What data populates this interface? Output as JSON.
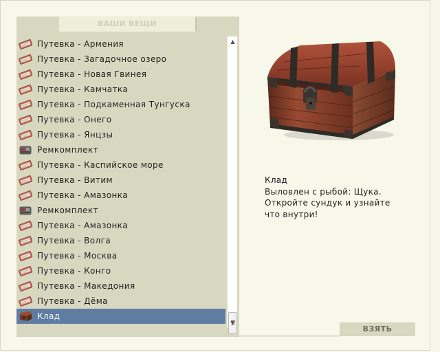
{
  "panel": {
    "title": "ВАШИ ВЕЩИ"
  },
  "items": [
    {
      "label": "Путевка - Армения",
      "icon": "ticket-icon"
    },
    {
      "label": "Путевка - Загадочное озеро",
      "icon": "ticket-icon"
    },
    {
      "label": "Путевка - Новая Гвинея",
      "icon": "ticket-icon"
    },
    {
      "label": "Путевка - Камчатка",
      "icon": "ticket-icon"
    },
    {
      "label": "Путевка - Подкаменная Тунгуска",
      "icon": "ticket-icon"
    },
    {
      "label": "Путевка - Онего",
      "icon": "ticket-icon"
    },
    {
      "label": "Путевка - Янцзы",
      "icon": "ticket-icon"
    },
    {
      "label": "Ремкомплект",
      "icon": "repair-kit-icon"
    },
    {
      "label": "Путевка - Каспийское море",
      "icon": "ticket-icon"
    },
    {
      "label": "Путевка - Витим",
      "icon": "ticket-icon"
    },
    {
      "label": "Путевка - Амазонка",
      "icon": "ticket-icon"
    },
    {
      "label": "Ремкомплект",
      "icon": "repair-kit-icon"
    },
    {
      "label": "Путевка - Амазонка",
      "icon": "ticket-icon"
    },
    {
      "label": "Путевка - Волга",
      "icon": "ticket-icon"
    },
    {
      "label": "Путевка - Москва",
      "icon": "ticket-icon"
    },
    {
      "label": "Путевка - Конго",
      "icon": "ticket-icon"
    },
    {
      "label": "Путевка - Македония",
      "icon": "ticket-icon"
    },
    {
      "label": "Путевка - Дёма",
      "icon": "ticket-icon"
    },
    {
      "label": "Клад",
      "icon": "chest-icon",
      "selected": true
    }
  ],
  "detail": {
    "image": "treasure-chest-image",
    "name": "Клад",
    "line1": "Выловлен с рыбой: Щука.",
    "line2": "Откройте сундук и узнайте",
    "line3": "что внутри!"
  },
  "actions": {
    "take_label": "ВЗЯТЬ"
  },
  "colors": {
    "panel_bg": "#d8d8c0",
    "selected_bg": "#5f7ca3",
    "window_bg": "#f7f7ea"
  }
}
